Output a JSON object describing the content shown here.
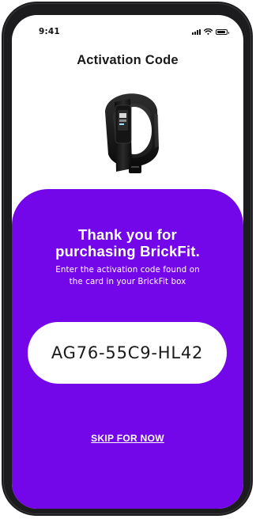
{
  "status_bar": {
    "time": "9:41",
    "icons": [
      "signal-icon",
      "wifi-icon",
      "battery-icon"
    ]
  },
  "header": {
    "title": "Activation Code"
  },
  "product": {
    "image_icon": "fitness-band-image"
  },
  "card": {
    "heading_line1": "Thank you for",
    "heading_line2": "purchasing BrickFit.",
    "subtext_line1": "Enter the activation code found on",
    "subtext_line2": "the card in your BrickFit box",
    "code_value": "AG76-55C9-HL42",
    "skip_label": "SKIP FOR NOW"
  },
  "colors": {
    "accent": "#7406ea",
    "phone_frame": "#1c1c1e",
    "text_dark": "#1a1a1a",
    "card_text": "#ffffff"
  }
}
